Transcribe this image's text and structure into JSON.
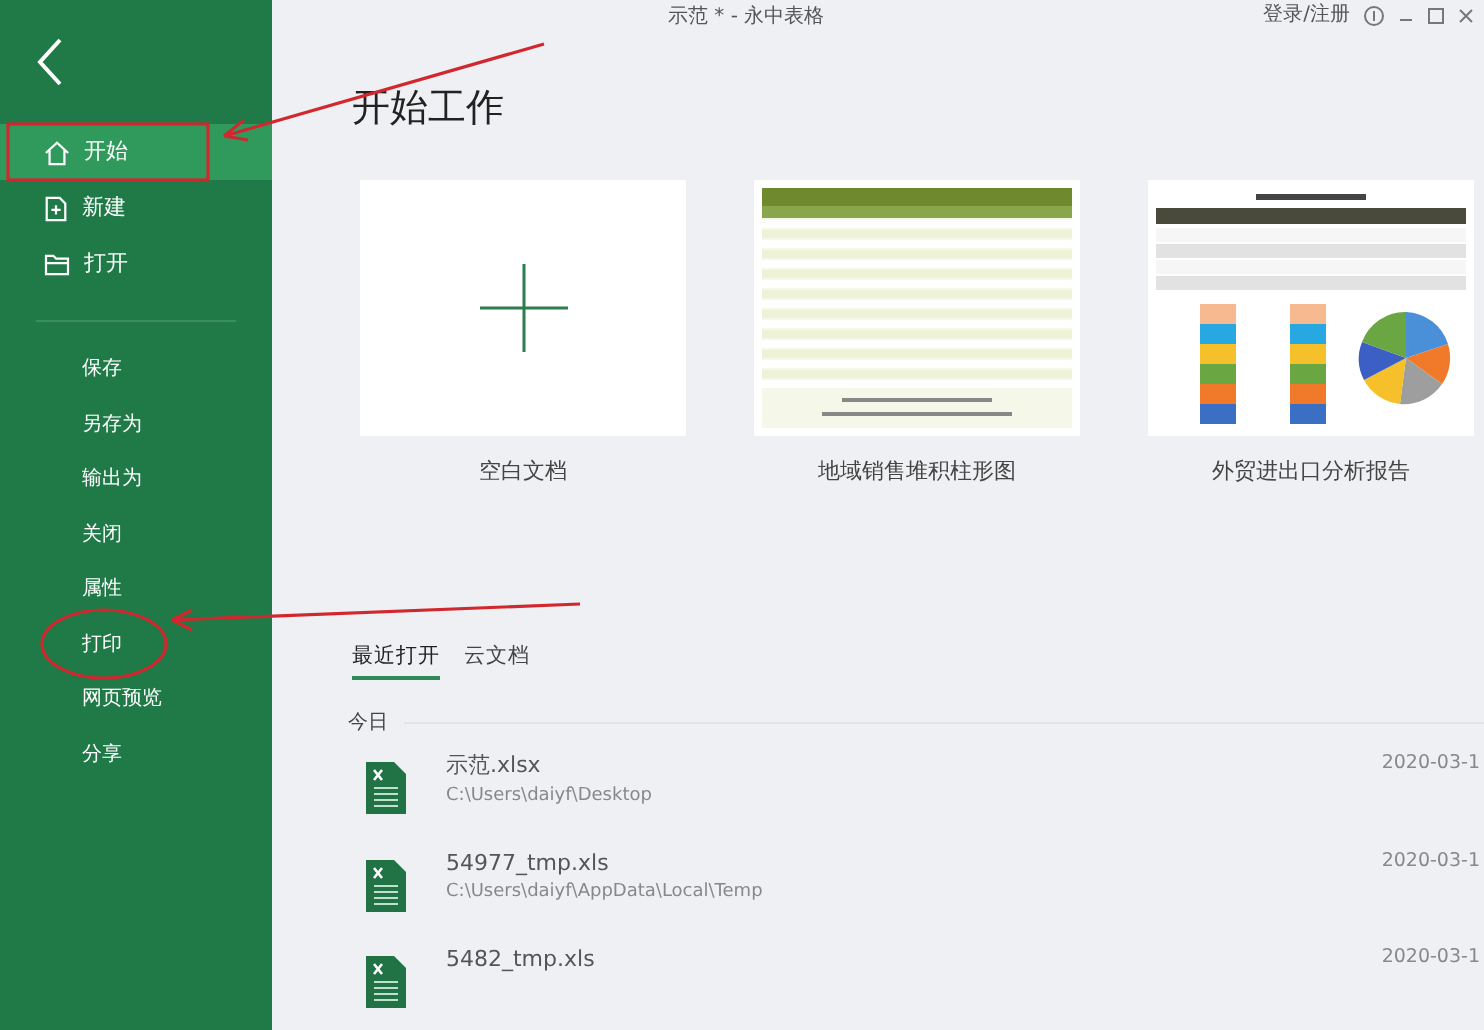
{
  "window": {
    "title": "示范 * - 永中表格",
    "login": "登录/注册"
  },
  "sidebar": {
    "primary": [
      {
        "label": "开始",
        "kind": "home",
        "selected": true
      },
      {
        "label": "新建",
        "kind": "new",
        "selected": false
      },
      {
        "label": "打开",
        "kind": "open",
        "selected": false
      }
    ],
    "secondary": [
      {
        "label": "保存"
      },
      {
        "label": "另存为"
      },
      {
        "label": "输出为"
      },
      {
        "label": "关闭"
      },
      {
        "label": "属性"
      },
      {
        "label": "打印"
      },
      {
        "label": "网页预览"
      },
      {
        "label": "分享"
      }
    ]
  },
  "heading": "开始工作",
  "templates": [
    {
      "label": "空白文档",
      "kind": "blank"
    },
    {
      "label": "地域销售堆积柱形图",
      "kind": "table"
    },
    {
      "label": "外贸进出口分析报告",
      "kind": "report"
    }
  ],
  "tabs": [
    {
      "label": "最近打开",
      "selected": true
    },
    {
      "label": "云文档",
      "selected": false
    }
  ],
  "group": "今日",
  "files": [
    {
      "name": "示范.xlsx",
      "path": "C:\\Users\\daiyf\\Desktop",
      "date": "2020-03-1"
    },
    {
      "name": "54977_tmp.xls",
      "path": "C:\\Users\\daiyf\\AppData\\Local\\Temp",
      "date": "2020-03-1"
    },
    {
      "name": "5482_tmp.xls",
      "date": "2020-03-1"
    }
  ]
}
